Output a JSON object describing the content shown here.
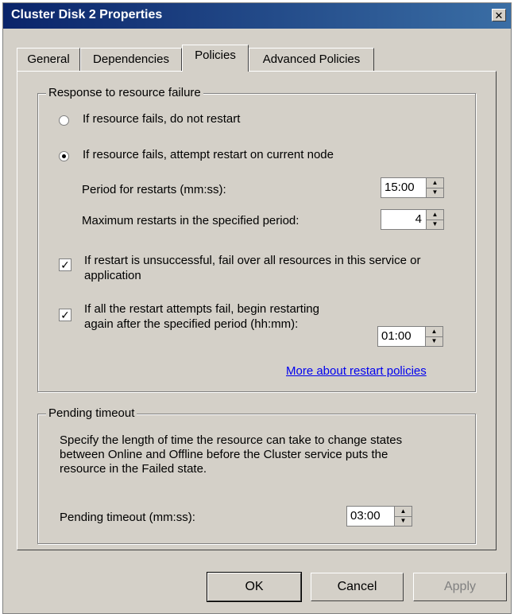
{
  "window": {
    "title": "Cluster Disk 2 Properties",
    "close_label": "✕"
  },
  "tabs": [
    {
      "label": "General"
    },
    {
      "label": "Dependencies"
    },
    {
      "label": "Policies"
    },
    {
      "label": "Advanced Policies"
    }
  ],
  "response_group": {
    "title": "Response to resource failure",
    "radio_no_restart": "If resource fails, do not restart",
    "radio_restart": "If resource fails, attempt restart on current node",
    "period_label": "Period for restarts (mm:ss):",
    "period_value": "15:00",
    "max_label": "Maximum restarts in the specified period:",
    "max_value": "4",
    "failover_line1": "If restart is unsuccessful, fail over all resources in this service or",
    "failover_line2": "application",
    "restart_again_line1": "If all the restart attempts fail, begin restarting",
    "restart_again_line2": "again after the specified period (hh:mm):",
    "restart_again_value": "01:00",
    "more_link": "More about restart policies"
  },
  "pending_group": {
    "title": "Pending timeout",
    "desc_line1": "Specify the length of time the resource can take to change states",
    "desc_line2": "between Online and Offline before the Cluster service puts the",
    "desc_line3": "resource in the Failed state.",
    "timeout_label": "Pending timeout (mm:ss):",
    "timeout_value": "03:00"
  },
  "buttons": {
    "ok": "OK",
    "cancel": "Cancel",
    "apply": "Apply"
  }
}
